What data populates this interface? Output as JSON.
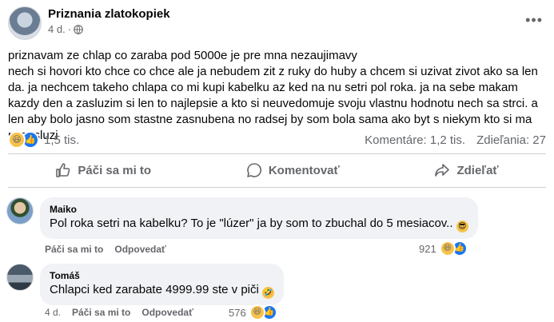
{
  "post": {
    "page_name": "Priznania zlatokopiek",
    "time": "4 d.",
    "visibility_icon": "globe-icon",
    "text": "priznavam ze chlap co zaraba pod 5000e je pre mna nezaujimavy\nnech si hovori kto chce co chce ale ja nebudem zit z ruky do huby a chcem si uzivat zivot ako sa len da. ja nechcem takeho chlapa co mi kupi kabelku az ked na nu setri pol roka. ja na sebe makam kazdy den a zasluzim si len to najlepsie a kto si neuvedomuje svoju vlastnu hodnotu nech sa strci. a len aby bolo jasno som stastne zasnubena no radsej by som bola sama ako byt s niekym kto si ma nezasluzi",
    "reaction_count": "1,5 tis.",
    "comments_count": "Komentáre: 1,2 tis.",
    "shares_count": "Zdieľania: 27"
  },
  "actions": {
    "like": "Páči sa mi to",
    "comment": "Komentovať",
    "share": "Zdieľať"
  },
  "comments": [
    {
      "author": "Maiko",
      "text": "Pol roka setri na kabelku? To je \"lúzer\" ja by som to zbuchal do 5 mesiacov..",
      "time": "",
      "like_label": "Páči sa mi to",
      "reply_label": "Odpovedať",
      "reaction_count": "921"
    },
    {
      "author": "Tomáš",
      "text": "Chlapci ked zarabate 4999.99 ste v piči",
      "time": "4 d.",
      "like_label": "Páči sa mi to",
      "reply_label": "Odpovedať",
      "reaction_count": "576"
    }
  ],
  "colors": {
    "accent": "#1877f2",
    "secondary_text": "#65676b",
    "bubble": "#f0f2f5"
  }
}
